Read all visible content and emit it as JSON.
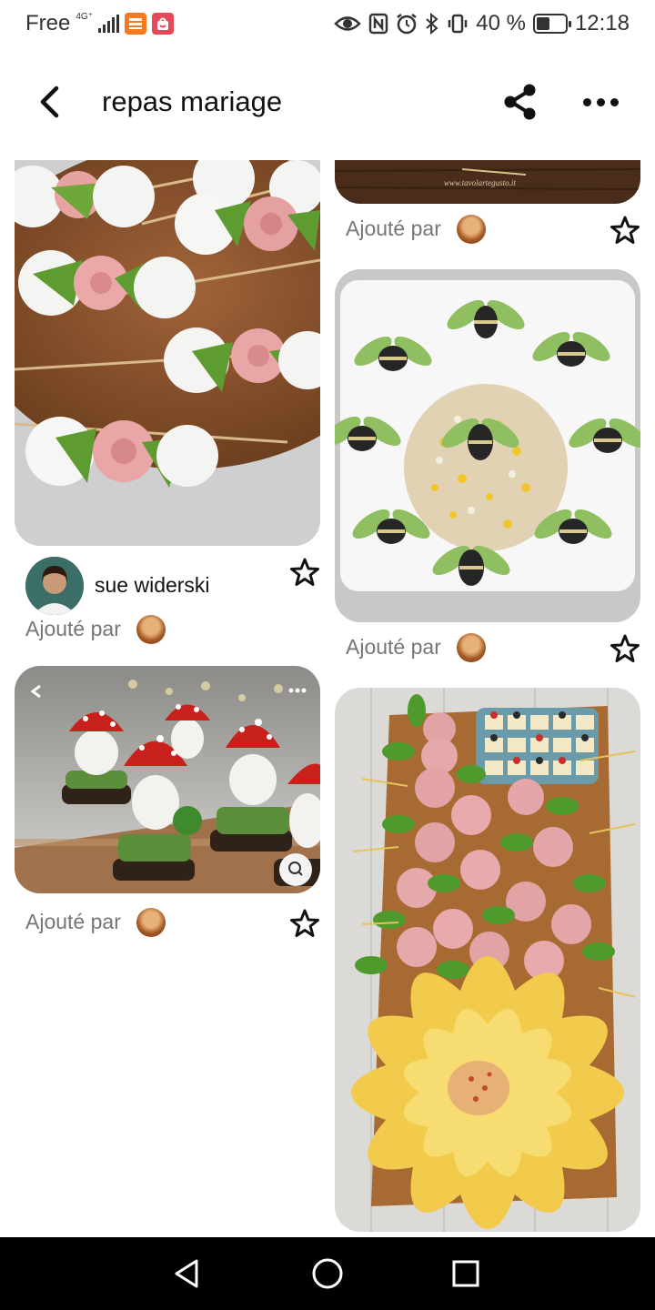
{
  "status_bar": {
    "carrier": "Free",
    "network_type": "4G⁺",
    "signal_icon": "signal-bars-icon",
    "app_badges": [
      "temu-app-icon",
      "shopping-app-icon"
    ],
    "battery_percent": "40 %",
    "time": "12:18",
    "icons": [
      "eye-icon",
      "nfc-icon",
      "alarm-icon",
      "bluetooth-icon",
      "vibrate-icon",
      "battery-icon"
    ]
  },
  "header": {
    "title": "repas mariage",
    "back_icon": "chevron-left-icon",
    "share_icon": "share-icon",
    "more_icon": "more-horizontal-icon"
  },
  "pins": [
    {
      "id": "skewers",
      "description": "mozzarella and ham rose skewers",
      "added_label": "Ajouté par",
      "creator": "sue widerski",
      "saved": false
    },
    {
      "id": "wood-top",
      "description": "wooden board image (partially visible)",
      "watermark": "www.tavolartegusto.it",
      "added_label": "Ajouté par",
      "saved": false
    },
    {
      "id": "bees",
      "description": "rice salad with cucumber olive bees",
      "added_label": "Ajouté par",
      "saved": false
    },
    {
      "id": "mushrooms",
      "description": "tomato and egg mushrooms",
      "added_label": "Ajouté par",
      "saved": false
    },
    {
      "id": "platter",
      "description": "ham roses platter with chip flower",
      "saved": false
    }
  ],
  "nav_bar": {
    "back_icon": "triangle-back-icon",
    "home_icon": "circle-home-icon",
    "recents_icon": "square-recents-icon"
  },
  "colors": {
    "accent_text": "#111111",
    "secondary_text": "#767676",
    "navbar_background": "#000000"
  }
}
